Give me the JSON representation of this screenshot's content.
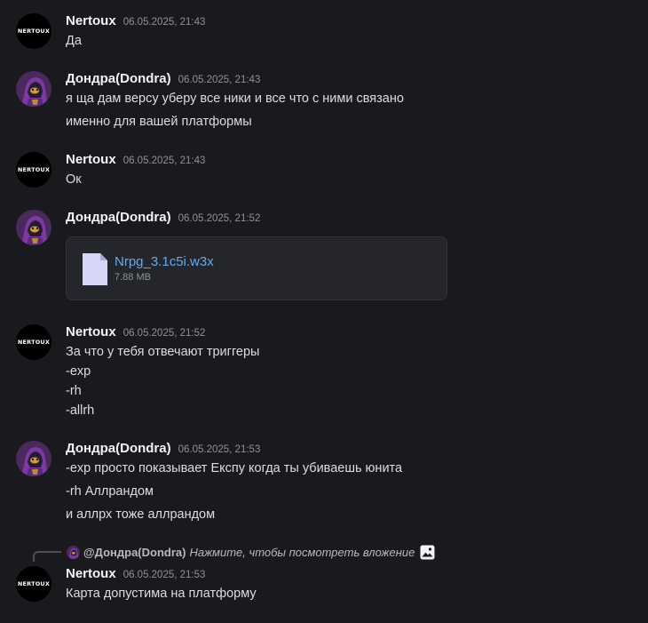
{
  "messages": [
    {
      "author": "Nertoux",
      "avatar_text": "NERTOUX",
      "timestamp": "06.05.2025, 21:43",
      "lines": [
        "Да"
      ]
    },
    {
      "author": "Дондра(Dondra)",
      "timestamp": "06.05.2025, 21:43",
      "lines": [
        "я ща дам версу уберу все ники и все что с ними связано",
        "именно для вашей платформы"
      ]
    },
    {
      "author": "Nertoux",
      "avatar_text": "NERTOUX",
      "timestamp": "06.05.2025, 21:43",
      "lines": [
        "Ок"
      ]
    },
    {
      "author": "Дондра(Dondra)",
      "timestamp": "06.05.2025, 21:52",
      "attachment": {
        "file_name": "Nrpg_3.1c5i.w3x",
        "file_size": "7.88 MB",
        "icon": "file-icon"
      }
    },
    {
      "author": "Nertoux",
      "avatar_text": "NERTOUX",
      "timestamp": "06.05.2025, 21:52",
      "lines": [
        "За что у тебя отвечают триггеры",
        "-exp",
        "-rh",
        "-allrh"
      ]
    },
    {
      "author": "Дондра(Dondra)",
      "timestamp": "06.05.2025, 21:53",
      "lines": [
        "-exp просто показывает Експу когда ты убиваешь юнита",
        "-rh Аллрандом",
        "и аллрх тоже аллрандом"
      ]
    },
    {
      "author": "Nertoux",
      "avatar_text": "NERTOUX",
      "timestamp": "06.05.2025, 21:53",
      "reply": {
        "author": "@Дондра(Dondra)",
        "text": "Нажмите, чтобы посмотреть вложение",
        "icon": "image-icon"
      },
      "lines": [
        "Карта допустима на платформу"
      ]
    }
  ],
  "colors": {
    "background": "#1a1a1e",
    "author": "#f2f3f5",
    "timestamp": "#8e9297",
    "text": "#dbdee1",
    "link": "#68a7f0"
  }
}
